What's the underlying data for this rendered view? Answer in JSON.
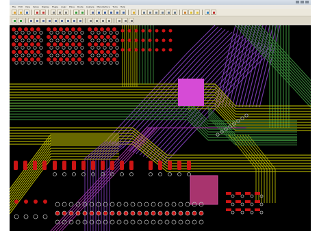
{
  "app": {
    "title": ""
  },
  "menu": [
    "File",
    "Edit",
    "View",
    "Setup",
    "Display",
    "Shape",
    "Logic",
    "Place",
    "Route",
    "Analyze",
    "Manufacture",
    "Tools",
    "Help"
  ],
  "toolbar_row1": [
    {
      "name": "new-icon",
      "color": "#e0a030"
    },
    {
      "name": "open-icon",
      "color": "#d9b040"
    },
    {
      "name": "save-icon",
      "color": "#4a6fb0"
    },
    {
      "name": "sep"
    },
    {
      "name": "undo-icon",
      "color": "#c03030"
    },
    {
      "name": "redo-icon",
      "color": "#c03030"
    },
    {
      "name": "sep"
    },
    {
      "name": "edit-icon",
      "color": "#808080"
    },
    {
      "name": "copy-icon",
      "color": "#808080"
    },
    {
      "name": "move-icon",
      "color": "#808080"
    },
    {
      "name": "sep"
    },
    {
      "name": "add-connect-icon",
      "color": "#2f9a3a"
    },
    {
      "name": "slide-icon",
      "color": "#2f9a3a"
    },
    {
      "name": "sep"
    },
    {
      "name": "grid-icon",
      "color": "#5a6a9a"
    },
    {
      "name": "zoom-in-icon",
      "color": "#4060a0"
    },
    {
      "name": "zoom-out-icon",
      "color": "#4060a0"
    },
    {
      "name": "zoom-fit-icon",
      "color": "#4060a0"
    },
    {
      "name": "zoom-prev-icon",
      "color": "#4060a0"
    },
    {
      "name": "redraw-icon",
      "color": "#4060a0"
    },
    {
      "name": "sep"
    },
    {
      "name": "folder-icon",
      "color": "#e0b030"
    },
    {
      "name": "sep"
    },
    {
      "name": "layer-icon",
      "color": "#6a7a8c"
    },
    {
      "name": "drc-icon",
      "color": "#6a7a8c"
    },
    {
      "name": "report-icon",
      "color": "#6a7a8c"
    },
    {
      "name": "measure-icon",
      "color": "#6a7a8c"
    },
    {
      "name": "3d-icon",
      "color": "#6a7a8c"
    },
    {
      "name": "shape-icon",
      "color": "#6a7a8c"
    },
    {
      "name": "sep"
    },
    {
      "name": "color-icon",
      "color": "#d08030"
    },
    {
      "name": "highlight-icon",
      "color": "#e0c030"
    },
    {
      "name": "dehighlight-icon",
      "color": "#e0c030"
    },
    {
      "name": "sep"
    },
    {
      "name": "net-icon",
      "color": "#3080c0"
    },
    {
      "name": "stop-icon",
      "color": "#c03030"
    }
  ],
  "toolbar_row2": [
    {
      "name": "layer-top-icon",
      "color": "#2f9a3a"
    },
    {
      "name": "layer-bottom-icon",
      "color": "#2f9a3a"
    },
    {
      "name": "sep"
    },
    {
      "name": "select-icon",
      "color": "#5a6a9a"
    },
    {
      "name": "snap-icon",
      "color": "#5a6a9a"
    },
    {
      "name": "route-icon",
      "color": "#5a6a9a"
    },
    {
      "name": "via-icon",
      "color": "#5a6a9a"
    },
    {
      "name": "fanout-icon",
      "color": "#5a6a9a"
    },
    {
      "name": "delay-tune-icon",
      "color": "#5a6a9a"
    },
    {
      "name": "bus-icon",
      "color": "#5a6a9a"
    },
    {
      "name": "spread-icon",
      "color": "#5a6a9a"
    },
    {
      "name": "glossing-icon",
      "color": "#5a6a9a"
    },
    {
      "name": "sep"
    },
    {
      "name": "text-icon",
      "color": "#7a7a7a"
    },
    {
      "name": "line-icon",
      "color": "#7a7a7a"
    },
    {
      "name": "arc-icon",
      "color": "#7a7a7a"
    },
    {
      "name": "rect-icon",
      "color": "#7a7a7a"
    },
    {
      "name": "sep"
    },
    {
      "name": "pin-icon",
      "color": "#7a7a7a"
    },
    {
      "name": "component-icon",
      "color": "#7a7a7a"
    },
    {
      "name": "symbol-icon",
      "color": "#7a7a7a"
    }
  ],
  "colors": {
    "background": "#000000",
    "pad": "#cc1414",
    "drill": "#b9b9b9",
    "trace_yellow": "#b8b800",
    "trace_green": "#3a8a3a",
    "trace_purple": "#7e3fb8",
    "trace_magenta": "#b035b0",
    "pad_large": "#d64bd6"
  }
}
